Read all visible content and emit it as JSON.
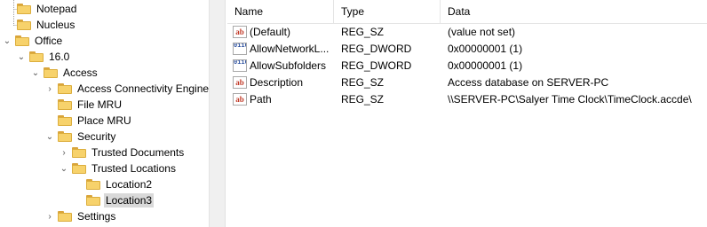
{
  "tree": {
    "nodes": [
      {
        "label": "Notepad",
        "expanded": null,
        "selected": false
      },
      {
        "label": "Nucleus",
        "expanded": null,
        "selected": false
      },
      {
        "label": "Office",
        "expanded": true,
        "selected": false
      },
      {
        "label": "16.0",
        "expanded": true,
        "selected": false
      },
      {
        "label": "Access",
        "expanded": true,
        "selected": false
      },
      {
        "label": "Access Connectivity Engine",
        "expanded": false,
        "selected": false
      },
      {
        "label": "File MRU",
        "expanded": null,
        "selected": false
      },
      {
        "label": "Place MRU",
        "expanded": null,
        "selected": false
      },
      {
        "label": "Security",
        "expanded": true,
        "selected": false
      },
      {
        "label": "Trusted Documents",
        "expanded": false,
        "selected": false
      },
      {
        "label": "Trusted Locations",
        "expanded": true,
        "selected": false
      },
      {
        "label": "Location2",
        "expanded": null,
        "selected": false
      },
      {
        "label": "Location3",
        "expanded": null,
        "selected": true
      },
      {
        "label": "Settings",
        "expanded": false,
        "selected": false
      }
    ]
  },
  "columns": {
    "name": "Name",
    "type": "Type",
    "data": "Data"
  },
  "values": [
    {
      "icon": "string-value-icon",
      "name": "(Default)",
      "type": "REG_SZ",
      "data": "(value not set)"
    },
    {
      "icon": "dword-value-icon",
      "name": "AllowNetworkL...",
      "type": "REG_DWORD",
      "data": "0x00000001 (1)"
    },
    {
      "icon": "dword-value-icon",
      "name": "AllowSubfolders",
      "type": "REG_DWORD",
      "data": "0x00000001 (1)"
    },
    {
      "icon": "string-value-icon",
      "name": "Description",
      "type": "REG_SZ",
      "data": "Access database on SERVER-PC"
    },
    {
      "icon": "string-value-icon",
      "name": "Path",
      "type": "REG_SZ",
      "data": "\\\\SERVER-PC\\Salyer Time Clock\\TimeClock.accde\\"
    }
  ],
  "icons": {
    "string_glyph": "ab",
    "dword_glyph": "0110"
  },
  "colors": {
    "folder": "#f7d26b",
    "selection": "#d9d9d9"
  }
}
